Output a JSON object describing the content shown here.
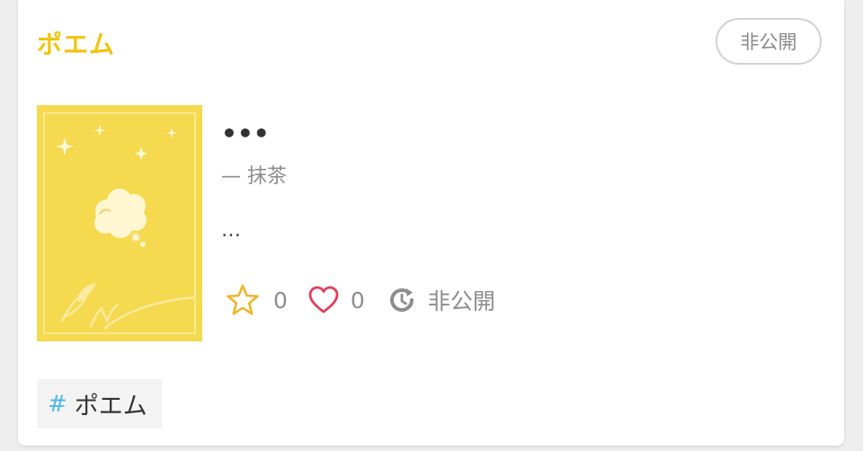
{
  "card": {
    "category": "ポエム",
    "status_button": "非公開",
    "cover_icon": "poem-cover",
    "title": "•••",
    "author": "— 抹茶",
    "excerpt": "…",
    "stats": {
      "stars": "0",
      "likes": "0",
      "visibility": "非公開"
    },
    "tag": {
      "hash": "#",
      "label": "ポエム"
    }
  },
  "colors": {
    "accent": "#f2c413",
    "cover_bg": "#f5d94f",
    "star": "#f0b429",
    "heart": "#e23c5a",
    "hash": "#4db8e8"
  }
}
